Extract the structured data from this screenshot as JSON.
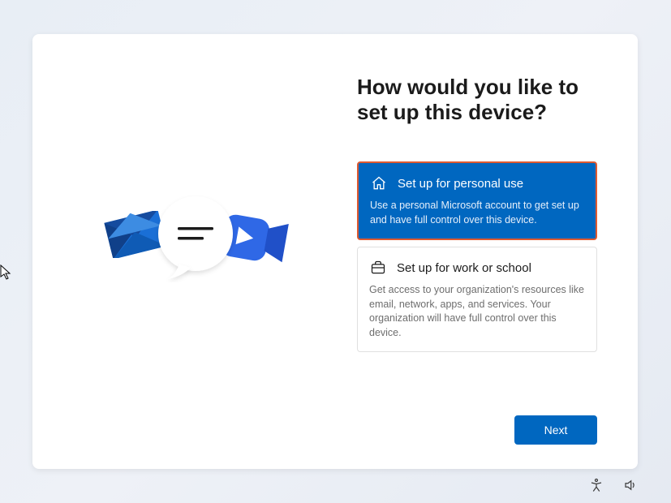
{
  "title": "How would you like to set up this device?",
  "options": {
    "personal": {
      "title": "Set up for personal use",
      "description": "Use a personal Microsoft account to get set up and have full control over this device."
    },
    "work": {
      "title": "Set up for work or school",
      "description": "Get access to your organization's resources like email, network, apps, and services. Your organization will have full control over this device."
    }
  },
  "buttons": {
    "next": "Next"
  },
  "colors": {
    "accent": "#0067c0",
    "highlightBorder": "#de5a31"
  }
}
